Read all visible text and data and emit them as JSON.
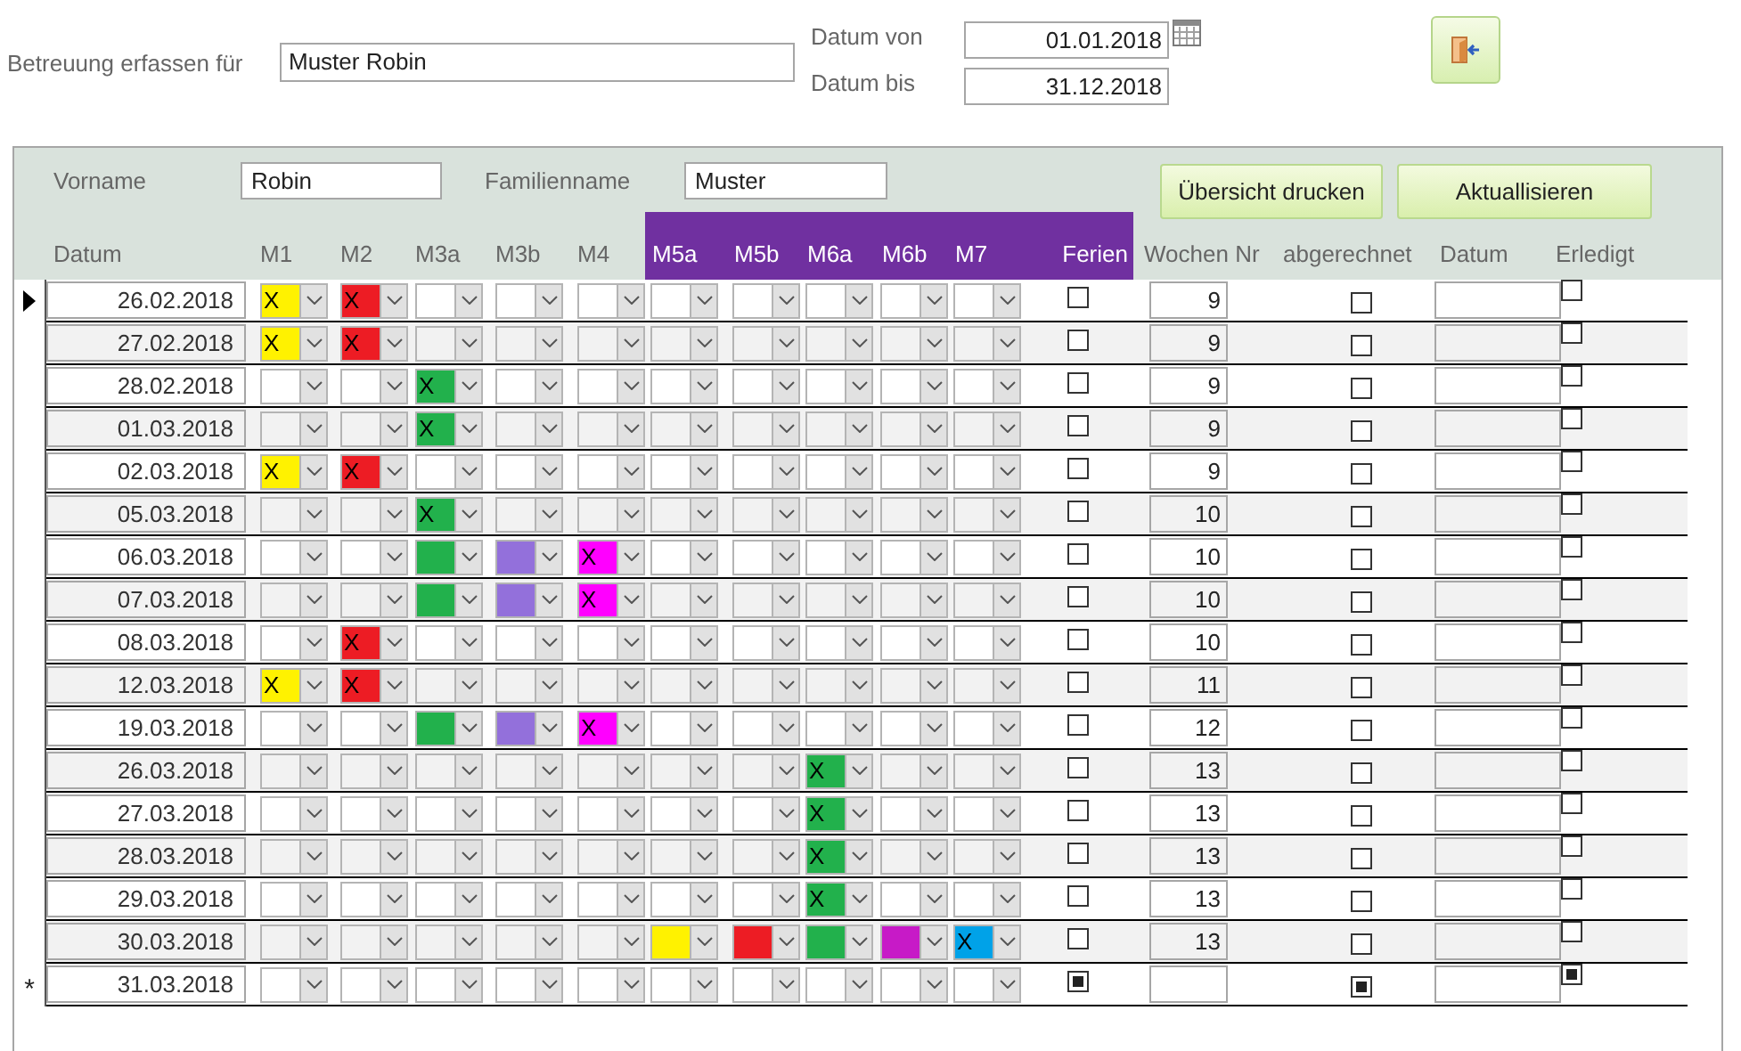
{
  "header": {
    "label": "Betreuung erfassen für",
    "value": "Muster Robin"
  },
  "date_range": [
    {
      "label": "Datum von",
      "value": "01.01.2018",
      "picker": true
    },
    {
      "label": "Datum bis",
      "value": "31.12.2018",
      "picker": false
    }
  ],
  "person_fields": [
    {
      "label": "Vorname",
      "value": "Robin"
    },
    {
      "label": "Familienname",
      "value": "Muster"
    }
  ],
  "buttons": [
    {
      "label": "Übersicht drucken"
    },
    {
      "label": "Aktuallisieren"
    }
  ],
  "columns": [
    {
      "label": "Datum",
      "highlighted": false
    },
    {
      "label": "M1",
      "highlighted": false
    },
    {
      "label": "M2",
      "highlighted": false
    },
    {
      "label": "M3a",
      "highlighted": false
    },
    {
      "label": "M3b",
      "highlighted": false
    },
    {
      "label": "M4",
      "highlighted": false
    },
    {
      "label": "M5a",
      "highlighted": true
    },
    {
      "label": "M5b",
      "highlighted": true
    },
    {
      "label": "M6a",
      "highlighted": true
    },
    {
      "label": "M6b",
      "highlighted": true
    },
    {
      "label": "M7",
      "highlighted": true
    },
    {
      "label": "Ferien",
      "highlighted": true
    },
    {
      "label": "Wochen Nr",
      "highlighted": false
    },
    {
      "label": "abgerechnet",
      "highlighted": false
    },
    {
      "label": "Datum",
      "highlighted": false
    },
    {
      "label": "Erledigt",
      "highlighted": false
    }
  ],
  "rows": [
    {
      "date": "26.02.2018",
      "current": true,
      "modules": {
        "m1": {
          "value": "X",
          "color": "#fff200"
        },
        "m2": {
          "value": "X",
          "color": "#ed1c24"
        }
      },
      "ferien": false,
      "week": "9",
      "abgerechnet": false,
      "erledigt": false
    },
    {
      "date": "27.02.2018",
      "current": false,
      "modules": {
        "m1": {
          "value": "X",
          "color": "#fff200"
        },
        "m2": {
          "value": "X",
          "color": "#ed1c24"
        }
      },
      "ferien": false,
      "week": "9",
      "abgerechnet": false,
      "erledigt": false
    },
    {
      "date": "28.02.2018",
      "current": false,
      "modules": {
        "m3a": {
          "value": "X",
          "color": "#22b14c"
        }
      },
      "ferien": false,
      "week": "9",
      "abgerechnet": false,
      "erledigt": false
    },
    {
      "date": "01.03.2018",
      "current": false,
      "modules": {
        "m3a": {
          "value": "X",
          "color": "#22b14c"
        }
      },
      "ferien": false,
      "week": "9",
      "abgerechnet": false,
      "erledigt": false
    },
    {
      "date": "02.03.2018",
      "current": false,
      "modules": {
        "m1": {
          "value": "X",
          "color": "#fff200"
        },
        "m2": {
          "value": "X",
          "color": "#ed1c24"
        }
      },
      "ferien": false,
      "week": "9",
      "abgerechnet": false,
      "erledigt": false
    },
    {
      "date": "05.03.2018",
      "current": false,
      "modules": {
        "m3a": {
          "value": "X",
          "color": "#22b14c"
        }
      },
      "ferien": false,
      "week": "10",
      "abgerechnet": false,
      "erledigt": false
    },
    {
      "date": "06.03.2018",
      "current": false,
      "modules": {
        "m3a": {
          "color": "#22b14c"
        },
        "m3b": {
          "color": "#9370db"
        },
        "m4": {
          "value": "X",
          "color": "#ff00ff"
        }
      },
      "ferien": false,
      "week": "10",
      "abgerechnet": false,
      "erledigt": false
    },
    {
      "date": "07.03.2018",
      "current": false,
      "modules": {
        "m3a": {
          "color": "#22b14c"
        },
        "m3b": {
          "color": "#9370db"
        },
        "m4": {
          "value": "X",
          "color": "#ff00ff"
        }
      },
      "ferien": false,
      "week": "10",
      "abgerechnet": false,
      "erledigt": false
    },
    {
      "date": "08.03.2018",
      "current": false,
      "modules": {
        "m2": {
          "value": "X",
          "color": "#ed1c24"
        }
      },
      "ferien": false,
      "week": "10",
      "abgerechnet": false,
      "erledigt": false
    },
    {
      "date": "12.03.2018",
      "current": false,
      "modules": {
        "m1": {
          "value": "X",
          "color": "#fff200"
        },
        "m2": {
          "value": "X",
          "color": "#ed1c24"
        }
      },
      "ferien": false,
      "week": "11",
      "abgerechnet": false,
      "erledigt": false
    },
    {
      "date": "19.03.2018",
      "current": false,
      "modules": {
        "m3a": {
          "color": "#22b14c"
        },
        "m3b": {
          "color": "#9370db"
        },
        "m4": {
          "value": "X",
          "color": "#ff00ff"
        }
      },
      "ferien": false,
      "week": "12",
      "abgerechnet": false,
      "erledigt": false
    },
    {
      "date": "26.03.2018",
      "current": false,
      "modules": {
        "m6a": {
          "value": "X",
          "color": "#22b14c"
        }
      },
      "ferien": false,
      "week": "13",
      "abgerechnet": false,
      "erledigt": false
    },
    {
      "date": "27.03.2018",
      "current": false,
      "modules": {
        "m6a": {
          "value": "X",
          "color": "#22b14c"
        }
      },
      "ferien": false,
      "week": "13",
      "abgerechnet": false,
      "erledigt": false
    },
    {
      "date": "28.03.2018",
      "current": false,
      "modules": {
        "m6a": {
          "value": "X",
          "color": "#22b14c"
        }
      },
      "ferien": false,
      "week": "13",
      "abgerechnet": false,
      "erledigt": false
    },
    {
      "date": "29.03.2018",
      "current": false,
      "modules": {
        "m6a": {
          "value": "X",
          "color": "#22b14c"
        }
      },
      "ferien": false,
      "week": "13",
      "abgerechnet": false,
      "erledigt": false
    },
    {
      "date": "30.03.2018",
      "current": false,
      "modules": {
        "m5a": {
          "color": "#fff200"
        },
        "m5b": {
          "color": "#ed1c24"
        },
        "m6a": {
          "color": "#22b14c"
        },
        "m6b": {
          "color": "#c71ac7"
        },
        "m7": {
          "value": "X",
          "color": "#00a2e8"
        }
      },
      "ferien": false,
      "week": "13",
      "abgerechnet": false,
      "erledigt": false
    },
    {
      "date": "31.03.2018",
      "current": false,
      "selector": "*",
      "ferien": null,
      "abgerechnet": null,
      "erledigt": null
    }
  ]
}
